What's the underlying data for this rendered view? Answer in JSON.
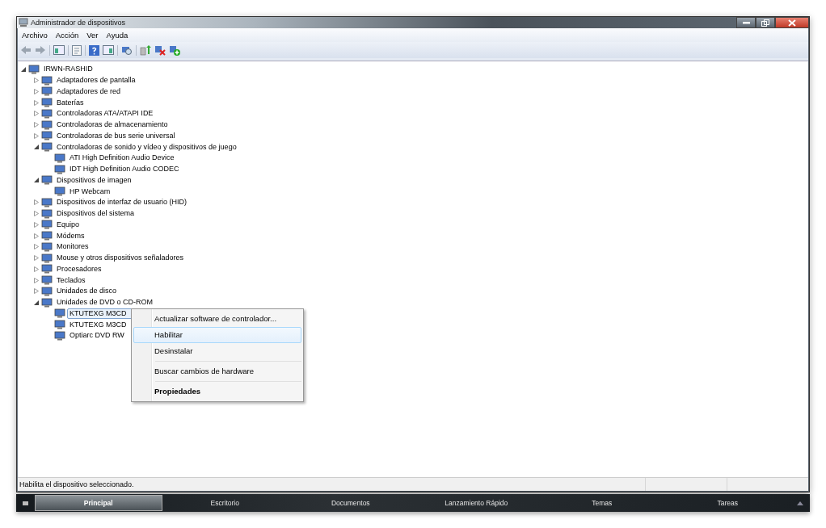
{
  "window": {
    "title": "Administrador de dispositivos"
  },
  "menu_bar": [
    "Archivo",
    "Acción",
    "Ver",
    "Ayuda"
  ],
  "tree": {
    "label": "IRWN-RASHID",
    "expanded": true,
    "children": [
      {
        "label": "Adaptadores de pantalla",
        "expanded": false
      },
      {
        "label": "Adaptadores de red",
        "expanded": false
      },
      {
        "label": "Baterías",
        "expanded": false
      },
      {
        "label": "Controladoras ATA/ATAPI IDE",
        "expanded": false
      },
      {
        "label": "Controladoras de almacenamiento",
        "expanded": false
      },
      {
        "label": "Controladoras de bus serie universal",
        "expanded": false
      },
      {
        "label": "Controladoras de sonido y vídeo y dispositivos de juego",
        "expanded": true,
        "children": [
          {
            "label": "ATI High Definition Audio Device",
            "selected": false
          },
          {
            "label": "IDT High Definition Audio CODEC",
            "selected": false
          }
        ]
      },
      {
        "label": "Dispositivos de imagen",
        "expanded": true,
        "children": [
          {
            "label": "HP Webcam",
            "selected": false
          }
        ]
      },
      {
        "label": "Dispositivos de interfaz de usuario (HID)",
        "expanded": false
      },
      {
        "label": "Dispositivos del sistema",
        "expanded": false
      },
      {
        "label": "Equipo",
        "expanded": false
      },
      {
        "label": "Módems",
        "expanded": false
      },
      {
        "label": "Monitores",
        "expanded": false
      },
      {
        "label": "Mouse y otros dispositivos señaladores",
        "expanded": false
      },
      {
        "label": "Procesadores",
        "expanded": false
      },
      {
        "label": "Teclados",
        "expanded": false
      },
      {
        "label": "Unidades de disco",
        "expanded": false
      },
      {
        "label": "Unidades de DVD o CD-ROM",
        "expanded": true,
        "children": [
          {
            "label": "KTUTEXG M3CD",
            "selected": true
          },
          {
            "label": "KTUTEXG M3CD",
            "selected": false
          },
          {
            "label": "Optiarc DVD RW",
            "selected": false
          }
        ]
      }
    ]
  },
  "context_menu": [
    {
      "items": [
        {
          "label": "Actualizar software de controlador...",
          "selected": false,
          "default": false
        },
        {
          "label": "Habilitar",
          "selected": true,
          "default": false
        },
        {
          "label": "Desinstalar",
          "selected": false,
          "default": false
        }
      ]
    },
    {
      "items": [
        {
          "label": "Buscar cambios de hardware",
          "selected": false,
          "default": false
        }
      ]
    },
    {
      "items": [
        {
          "label": "Propiedades",
          "selected": false,
          "default": true
        }
      ]
    }
  ],
  "status_bar": "Habilita el dispositivo seleccionado.",
  "taskbar": [
    {
      "label": "Principal",
      "selected": true
    },
    {
      "label": "Escritorio",
      "selected": false
    },
    {
      "label": "Documentos",
      "selected": false
    },
    {
      "label": "Lanzamiento Rápido",
      "selected": false
    },
    {
      "label": "Temas",
      "selected": false
    },
    {
      "label": "Tareas",
      "selected": false
    }
  ]
}
